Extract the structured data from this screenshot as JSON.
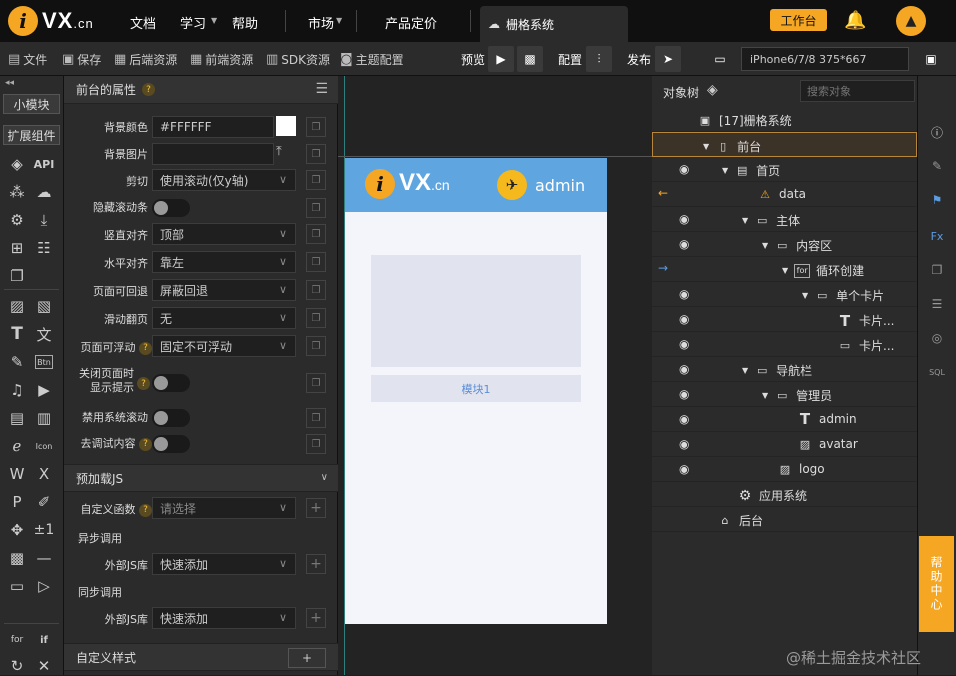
{
  "app": {
    "brand": "VX",
    "brand_suffix": ".cn"
  },
  "topnav": {
    "docs": "文档",
    "learn": "学习",
    "help": "帮助",
    "market": "市场",
    "pricing": "产品定价",
    "active_tab": "栅格系统",
    "workbench": "工作台"
  },
  "toolbar": {
    "file": "文件",
    "save": "保存",
    "backend": "后端资源",
    "frontend": "前端资源",
    "sdk": "SDK资源",
    "theme": "主题配置",
    "preview": "预览",
    "config": "配置",
    "publish": "发布",
    "device": "iPhone6/7/8 375*667"
  },
  "leftcol": {
    "small_module": "小模块",
    "ext_comp": "扩展组件",
    "api": "API",
    "pm": "±1",
    "btn": "Btn",
    "icon": "Icon",
    "for": "for",
    "if": "if"
  },
  "props": {
    "header": "前台的属性",
    "bg_color_label": "背景颜色",
    "bg_color_value": "#FFFFFF",
    "bg_image_label": "背景图片",
    "clip_label": "剪切",
    "clip_value": "使用滚动(仅y轴)",
    "hide_scrollbar_label": "隐藏滚动条",
    "valign_label": "竖直对齐",
    "valign_value": "顶部",
    "halign_label": "水平对齐",
    "halign_value": "靠左",
    "back_label": "页面可回退",
    "back_value": "屏蔽回退",
    "flip_label": "滑动翻页",
    "flip_value": "无",
    "float_label": "页面可浮动",
    "float_value": "固定不可浮动",
    "close_hint_label_1": "关闭页面时",
    "close_hint_label_2": "显示提示",
    "disable_scroll_label": "禁用系统滚动",
    "debug_label": "去调试内容",
    "preload_header": "预加载JS",
    "custom_fn_label": "自定义函数",
    "custom_fn_value": "请选择",
    "async_label": "异步调用",
    "ext_js_label": "外部JS库",
    "ext_js_value": "快速添加",
    "sync_label": "同步调用",
    "ext_js_label2": "外部JS库",
    "ext_js_value2": "快速添加",
    "custom_style_header": "自定义样式"
  },
  "phone": {
    "brand": "VX",
    "brand_suffix": ".cn",
    "user": "admin",
    "block_label": "模块1"
  },
  "tree": {
    "title": "对象树",
    "search_placeholder": "搜索对象",
    "rows": [
      {
        "label": "[17]栅格系统"
      },
      {
        "label": "前台"
      },
      {
        "label": "首页"
      },
      {
        "label": "data"
      },
      {
        "label": "主体"
      },
      {
        "label": "内容区"
      },
      {
        "label": "循环创建"
      },
      {
        "label": "单个卡片"
      },
      {
        "label": "卡片..."
      },
      {
        "label": "卡片..."
      },
      {
        "label": "导航栏"
      },
      {
        "label": "管理员"
      },
      {
        "label": "admin"
      },
      {
        "label": "avatar"
      },
      {
        "label": "logo"
      },
      {
        "label": "应用系统"
      },
      {
        "label": "后台"
      }
    ]
  },
  "help_center": "帮助中心",
  "watermark": "@稀土掘金技术社区",
  "colors": {
    "accent": "#f5a623",
    "phone_header": "#5fa6e0",
    "selected_row": "#3b3328"
  }
}
